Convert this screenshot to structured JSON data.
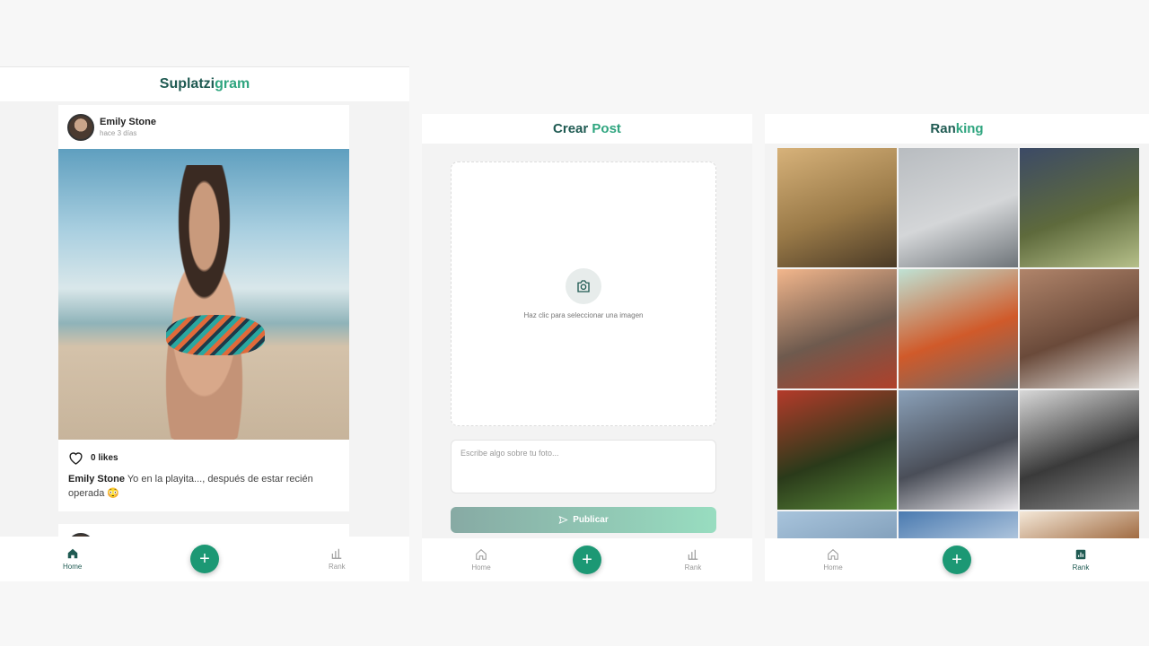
{
  "feed_screen": {
    "header": {
      "title_a": "Suplatzi",
      "title_b": "gram"
    },
    "post": {
      "user": "Emily Stone",
      "time": "hace 3 días",
      "likes": "0 likes",
      "caption_user": "Emily Stone",
      "caption_text": "Yo en la playita..., después de estar recién operada 😳"
    }
  },
  "create_screen": {
    "header": {
      "title_a": "Crear",
      "title_b": "Post"
    },
    "upload_hint": "Haz clic para seleccionar una imagen",
    "caption_placeholder": "Escribe algo sobre tu foto...",
    "publish_label": "Publicar"
  },
  "ranking_screen": {
    "header": {
      "title_a": "Ran",
      "title_b": "king"
    },
    "tiles": [
      {
        "name": "corridor-photo",
        "colors": [
          "#d7b27a",
          "#4a3a26",
          "#9a7a48"
        ]
      },
      {
        "name": "bridge-fog-photo",
        "colors": [
          "#b8bcc0",
          "#6e7479",
          "#d4d6d8"
        ]
      },
      {
        "name": "grapes-photo",
        "colors": [
          "#3c4a66",
          "#b6c08a",
          "#5e6a3c"
        ]
      },
      {
        "name": "golden-gate-photo",
        "colors": [
          "#f2b68c",
          "#b0402a",
          "#6e5a4e"
        ]
      },
      {
        "name": "stadium-photo",
        "colors": [
          "#bfe2d4",
          "#6a6a6a",
          "#d05a2a"
        ]
      },
      {
        "name": "fox-photo",
        "colors": [
          "#b0846a",
          "#e0dcd8",
          "#6a4a3a"
        ]
      },
      {
        "name": "rusty-tank-photo",
        "colors": [
          "#b43a2a",
          "#5a8a3a",
          "#2a3a1a"
        ]
      },
      {
        "name": "clouds-photo",
        "colors": [
          "#8aa0b8",
          "#e8e6ea",
          "#4a4e58"
        ]
      },
      {
        "name": "stone-wall-photo",
        "colors": [
          "#d8d8d8",
          "#8a8a8a",
          "#3a3a3a"
        ]
      },
      {
        "name": "sky-photo",
        "colors": [
          "#a8c4dc",
          "#e6eef4",
          "#7a98b4"
        ]
      },
      {
        "name": "blue-sky-photo",
        "colors": [
          "#4a7ab0",
          "#9ab8d6",
          "#c8d8e8"
        ]
      },
      {
        "name": "honey-photo",
        "colors": [
          "#f4e8d8",
          "#c07a2a",
          "#8a4a1a"
        ]
      }
    ]
  },
  "nav": {
    "home": "Home",
    "rank": "Rank",
    "add": "+"
  },
  "colors": {
    "brand_dark": "#1f5a52",
    "brand_light": "#2fa57f",
    "fab": "#1c9874"
  }
}
